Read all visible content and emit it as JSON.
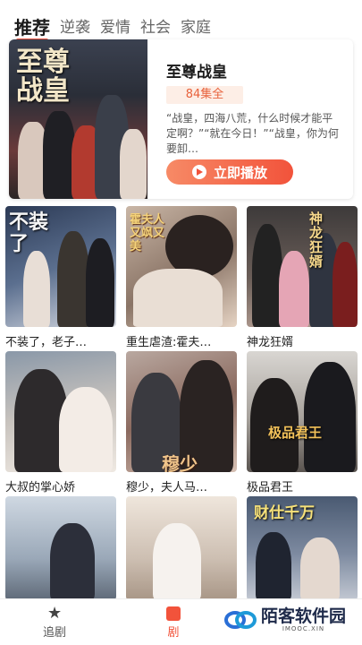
{
  "tabs": [
    {
      "label": "推荐",
      "active": true
    },
    {
      "label": "逆袭",
      "active": false
    },
    {
      "label": "爱情",
      "active": false
    },
    {
      "label": "社会",
      "active": false
    },
    {
      "label": "家庭",
      "active": false
    }
  ],
  "featured": {
    "poster_title": "至尊战皇",
    "title": "至尊战皇",
    "episodes": "84集全",
    "description": "“战皇，四海八荒，什么时候才能平定啊？”“就在今日！”“战皇，你为何要卸…",
    "play_label": "立即播放"
  },
  "dramas": [
    {
      "title": "不装了，老子…",
      "poster_text": "不装了"
    },
    {
      "title": "重生虐渣:霍夫…",
      "poster_text": "霍夫人又飒又美"
    },
    {
      "title": "神龙狂婿",
      "poster_text": "神龙狂婿"
    },
    {
      "title": "大叔的掌心娇",
      "poster_text": ""
    },
    {
      "title": "穆少，夫人马…",
      "poster_text": "穆少"
    },
    {
      "title": "极品君王",
      "poster_text": "极品君王"
    },
    {
      "title": "",
      "poster_text": ""
    },
    {
      "title": "",
      "poster_text": ""
    },
    {
      "title": "",
      "poster_text": "财仕千万"
    }
  ],
  "bottom_nav": {
    "follow_label": "追剧",
    "drama_label": "剧"
  },
  "watermark": {
    "text": "陌客软件园",
    "sub": "IMOOC.XIN"
  },
  "colors": {
    "accent": "#f2533b",
    "tag_bg": "#fdeee6"
  }
}
